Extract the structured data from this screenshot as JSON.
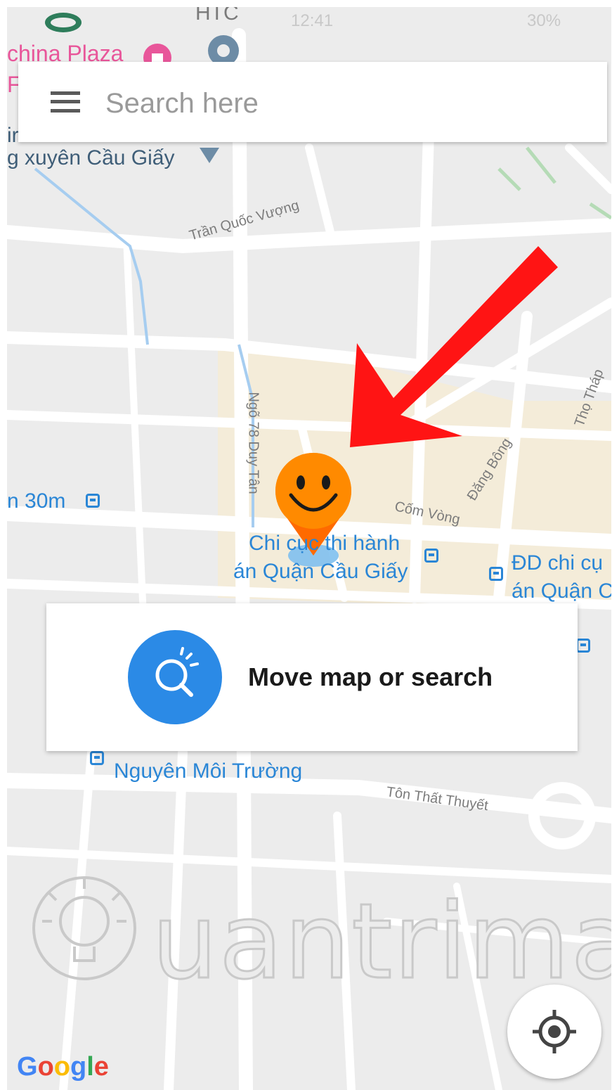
{
  "status_bar": {
    "carrier_mark": "HTC",
    "time": "12:41",
    "battery": "30%"
  },
  "search": {
    "placeholder": "Search here"
  },
  "map": {
    "places": {
      "plaza": "china Plaza",
      "plaza_clip": "F",
      "school_l1": "ir",
      "school_l2": "g xuyên Cầu Giấy",
      "bus_30m": "n 30m",
      "agency_l1": "Chi cục thi hành",
      "agency_l2": "án Quận Cầu Giấy",
      "dd_l1": "ĐD chi cụ",
      "dd_l2": "án Quận C",
      "env": "Nguyên Môi Trường"
    },
    "streets": {
      "tran_quoc_vuong": "Trần Quốc Vượng",
      "ngo_78_duy_tan": "Ngõ 78 Duy Tân",
      "com_vong": "Cốm Vòng",
      "dang_bong": "Đăng Bông",
      "tho_thap": "Thọ Tháp",
      "ton_that_thuyet": "Tôn Thất Thuyết"
    }
  },
  "info_card": {
    "text": "Move map or search"
  },
  "watermark": "uantrimang",
  "google_logo": [
    "G",
    "o",
    "o",
    "g",
    "l",
    "e"
  ],
  "colors": {
    "map_background": "#ececec",
    "road": "#ffffff",
    "highlight_area": "#f4ecd9",
    "poi_blue": "#2a86d6",
    "pink_poi": "#e8569a",
    "button_blue": "#2b8ae6",
    "arrow_red": "#ff1414",
    "pin_orange": "#ff8a00"
  },
  "icons": [
    "hamburger-menu-icon",
    "search-spark-icon",
    "my-location-icon",
    "smiley-map-pin-icon",
    "red-arrow-annotation",
    "transit-stop-icon",
    "place-marker-icon",
    "pink-poi-icon",
    "lightbulb-watermark-icon"
  ]
}
